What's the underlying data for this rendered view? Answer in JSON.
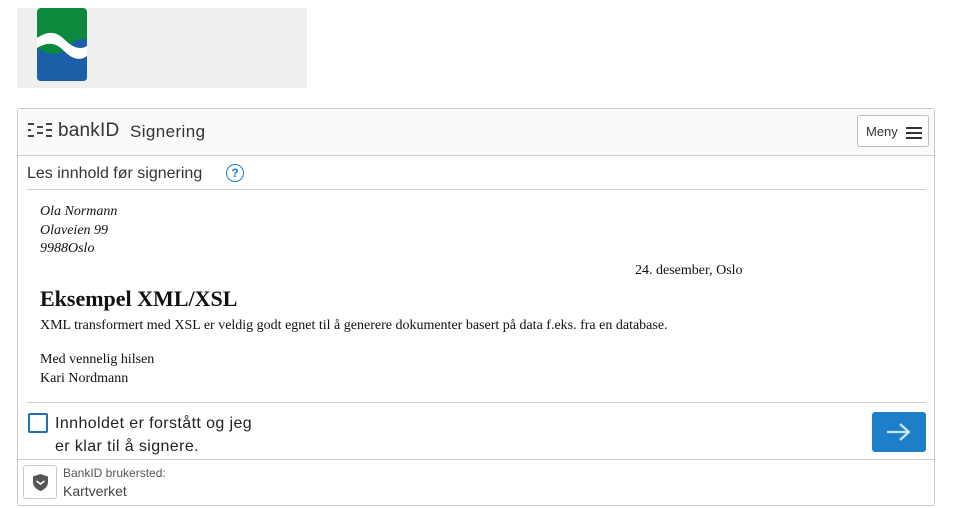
{
  "logo": {
    "name": "kartverket-logo-icon",
    "colors": {
      "green": "#0b8a3e",
      "blue": "#1a5fa8"
    }
  },
  "header": {
    "brand": "bankID",
    "title": "Signering",
    "menu_label": "Meny"
  },
  "subheader": {
    "text": "Les innhold før signering",
    "help_symbol": "?"
  },
  "document": {
    "address": [
      "Ola Normann",
      "Olaveien 99",
      "9988Oslo"
    ],
    "date": "24. desember, Oslo",
    "heading": "Eksempel XML/XSL",
    "body": "XML transformert med XSL er veldig godt egnet til å generere dokumenter basert på data f.eks. fra en database.",
    "closing": [
      "Med vennelig hilsen",
      "Kari Nordmann"
    ]
  },
  "confirm": {
    "label": "Innholdet er forstått og jeg er klar til å signere.",
    "checked": false
  },
  "next_button": {
    "icon": "arrow-right-icon",
    "color": "#1d7fc9"
  },
  "footer": {
    "merchant_label": "BankID brukersted:",
    "merchant_name": "Kartverket"
  }
}
